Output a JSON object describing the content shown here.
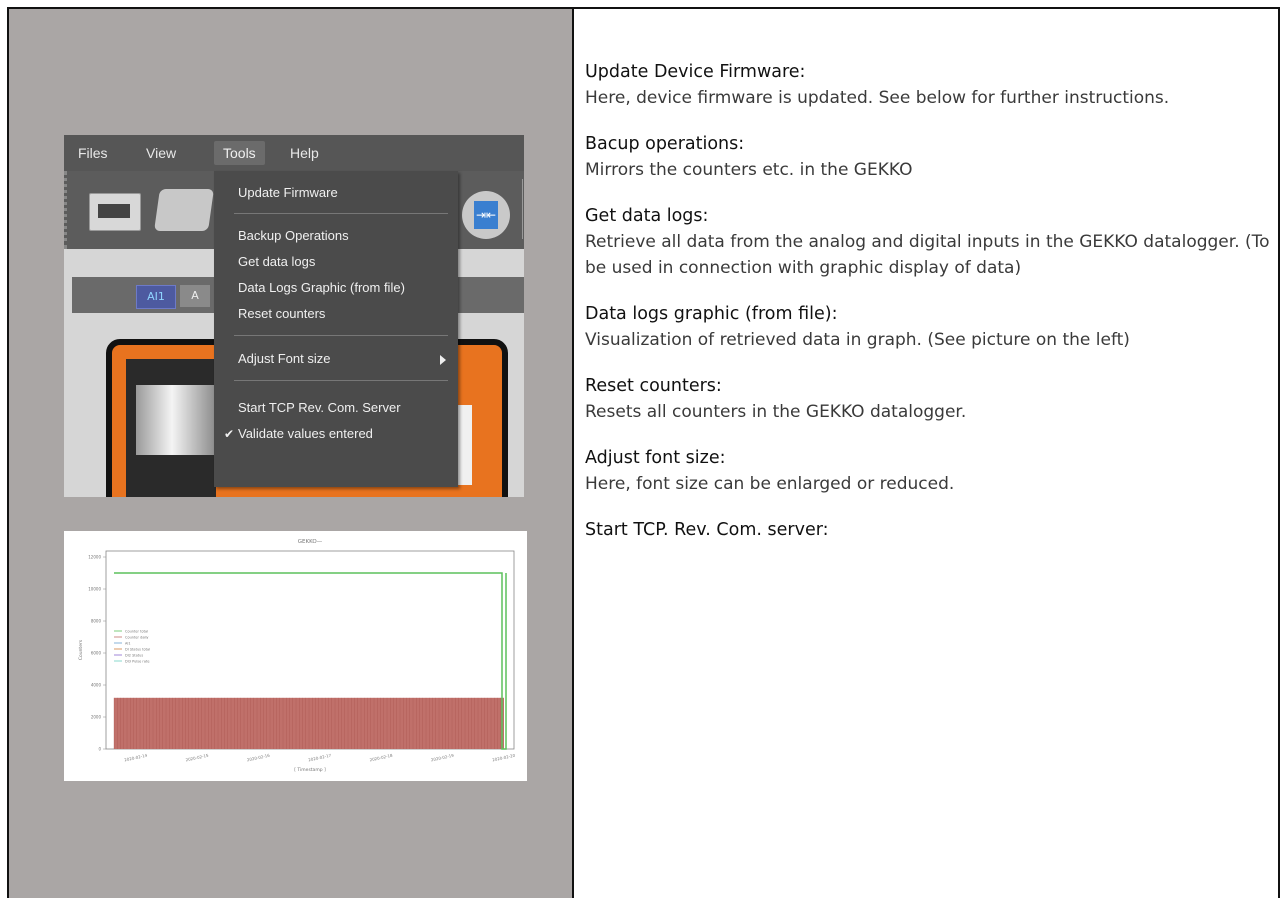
{
  "screenshot": {
    "menubar": [
      "Files",
      "View",
      "Tools",
      "Help"
    ],
    "active_menu": "Tools",
    "tabs": [
      "AI1",
      "A"
    ],
    "dropdown_items": [
      {
        "label": "Update Firmware"
      },
      {
        "label": "Backup Operations"
      },
      {
        "label": "Get data logs"
      },
      {
        "label": "Data Logs Graphic (from file)"
      },
      {
        "label": "Reset counters"
      },
      {
        "label": "Adjust Font size",
        "submenu": true
      },
      {
        "label": "Start TCP Rev. Com. Server"
      },
      {
        "label": "Validate values entered",
        "checked": true
      }
    ],
    "check_mark": "✔",
    "split_icon": "⇥⇤"
  },
  "chart_data": {
    "type": "area",
    "title": "GEKKO—",
    "xlabel": "[ Timestamp ]",
    "ylabel": "Counters",
    "ylim": [
      0,
      12000
    ],
    "yticks": [
      "12000",
      "10000",
      "8000",
      "6000",
      "4000",
      "2000",
      "0"
    ],
    "xticks": [
      "2020-02-14",
      "2020-02-15",
      "2020-02-16",
      "2020-02-17",
      "2020-02-18",
      "2020-02-19",
      "2020-02-20"
    ],
    "legend_position": "middle-left",
    "legend": [
      "Counter total",
      "Counter daily",
      "AI1",
      "DI Status total",
      "DI2 Status",
      "DI3 Pulse rate"
    ],
    "colors": {
      "line": "#5cc05c",
      "bars": "#c0706a"
    },
    "series": [
      {
        "name": "Counter total",
        "approx_value": 11000,
        "color": "#5cc05c"
      },
      {
        "name": "Counter daily",
        "approx_value": 3200,
        "color": "#c0706a"
      }
    ]
  },
  "sections": [
    {
      "heading": "Update Device Firmware:",
      "body": "Here, device firmware is updated. See below for further instructions."
    },
    {
      "heading": "Bacup operations:",
      "body": "Mirrors the counters etc. in the GEKKO"
    },
    {
      "heading": "Get data logs:",
      "body": "Retrieve all data from the analog and digital inputs in the GEKKO datalogger. (To be used in connection with graphic display of data)"
    },
    {
      "heading": "Data logs graphic (from file):",
      "body": "Visualization of retrieved data in graph. (See picture on the left)"
    },
    {
      "heading": "Reset counters:",
      "body": "Resets all counters in the GEKKO datalogger."
    },
    {
      "heading": "Adjust font size:",
      "body": "Here, font size can be enlarged or reduced."
    },
    {
      "heading": "Start TCP. Rev. Com. server:",
      "body": ""
    }
  ]
}
